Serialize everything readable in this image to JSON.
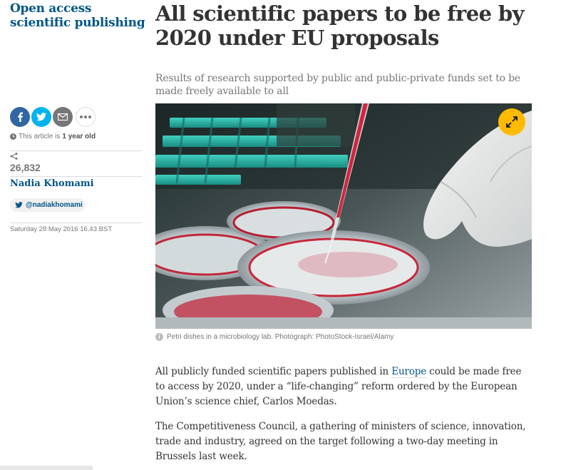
{
  "series": {
    "title": "Open access scientific publishing"
  },
  "article": {
    "headline": "All scientific papers to be free by 2020 under EU proposals",
    "standfirst": "Results of research supported by public and public-private funds set to be made freely available to all"
  },
  "sidebar": {
    "share_buttons": [
      {
        "icon": "facebook-icon",
        "color": "#3067a3"
      },
      {
        "icon": "twitter-icon",
        "color": "#03b3ee"
      },
      {
        "icon": "email-icon",
        "color": "#767676"
      },
      {
        "icon": "more-icon",
        "color": "#ffffff"
      }
    ],
    "age_prefix": "This article is",
    "age_value": "1 year old",
    "share_count": "26,832",
    "author": "Nadia Khomami",
    "twitter_handle": "@nadiakhomami",
    "date": "Saturday 28 May 2016 16.43 BST"
  },
  "image": {
    "caption": "Petri dishes in a microbiology lab. Photograph: PhotoStock-Israel/Alamy",
    "expand_color": "#ffbb00"
  },
  "body": {
    "p1_before": "All publicly funded scientific papers published in",
    "p1_link": "Europe",
    "p1_after": "could be made free to access by 2020, under a “life-changing” reform ordered by the European Union’s science chief, Carlos Moedas.",
    "p2": "The Competitiveness Council, a gathering of ministers of science, innovation, trade and industry, agreed on the target following a two-day meeting in Brussels last week."
  },
  "colors": {
    "accent": "#005689",
    "muted": "#767676"
  }
}
